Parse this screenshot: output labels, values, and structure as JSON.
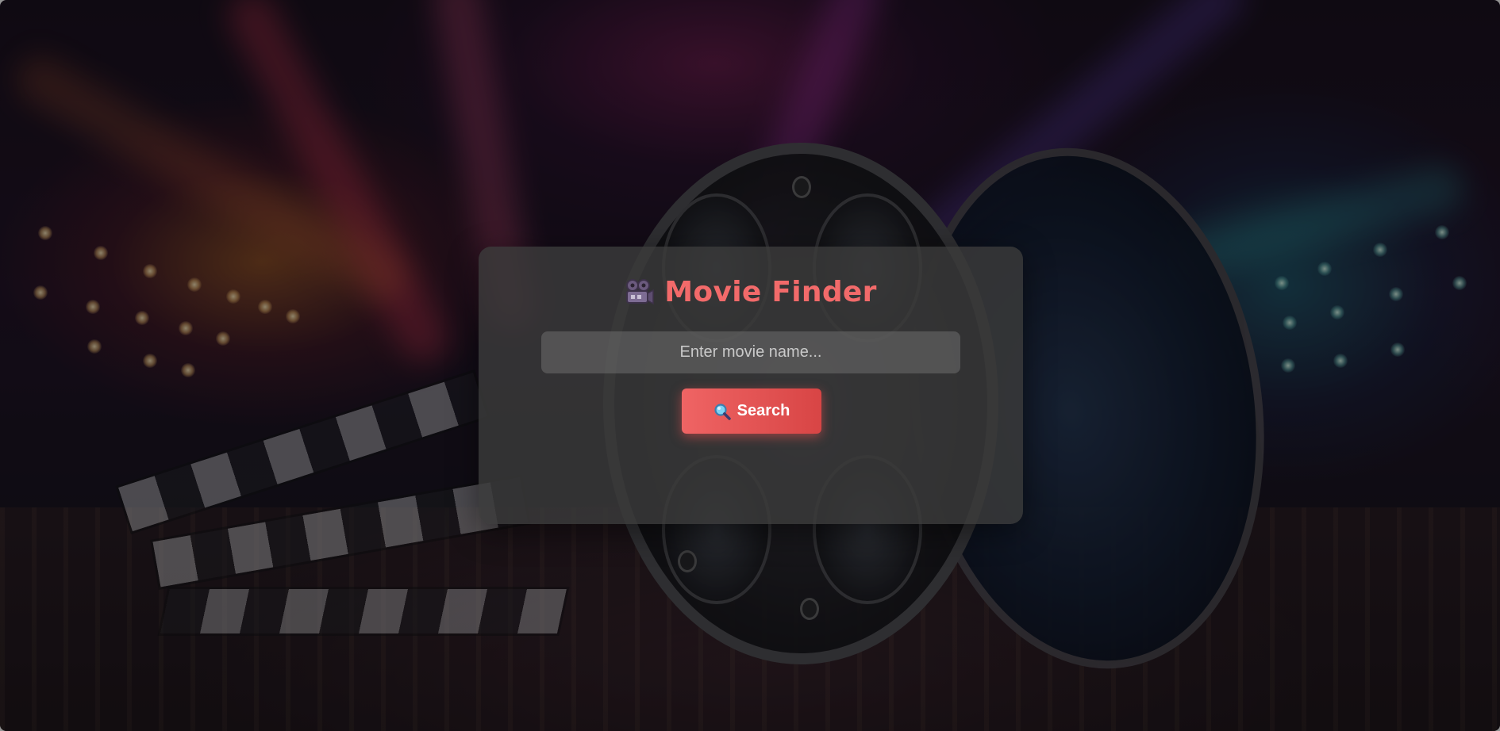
{
  "app": {
    "title": "Movie Finder",
    "title_icon": "movie-camera-icon",
    "title_color": "#f26a6a"
  },
  "search": {
    "value": "",
    "placeholder": "Enter movie name..."
  },
  "search_button": {
    "label": "Search",
    "icon": "magnifying-glass-icon",
    "color": "#e85656"
  },
  "background": {
    "description_icon": "film-reel-clapperboard-backdrop"
  }
}
